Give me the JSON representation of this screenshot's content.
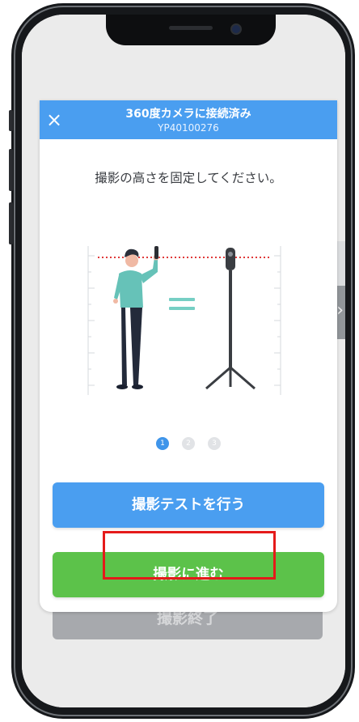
{
  "modal": {
    "title": "360度カメラに接続済み",
    "subtitle": "YP40100276",
    "instruction": "撮影の高さを固定してください。",
    "close_icon": "×"
  },
  "pagination": {
    "pages": [
      "1",
      "2",
      "3"
    ],
    "current": 1
  },
  "buttons": {
    "test_label": "撮影テストを行う",
    "proceed_label": "撮影に進む"
  },
  "background": {
    "end_label": "撮影終了",
    "next_icon": "›"
  },
  "colors": {
    "header_blue": "#4a9ef0",
    "proceed_green": "#5cc24a",
    "highlight_red": "#e51a1a",
    "equals_teal": "#76cfc4"
  }
}
